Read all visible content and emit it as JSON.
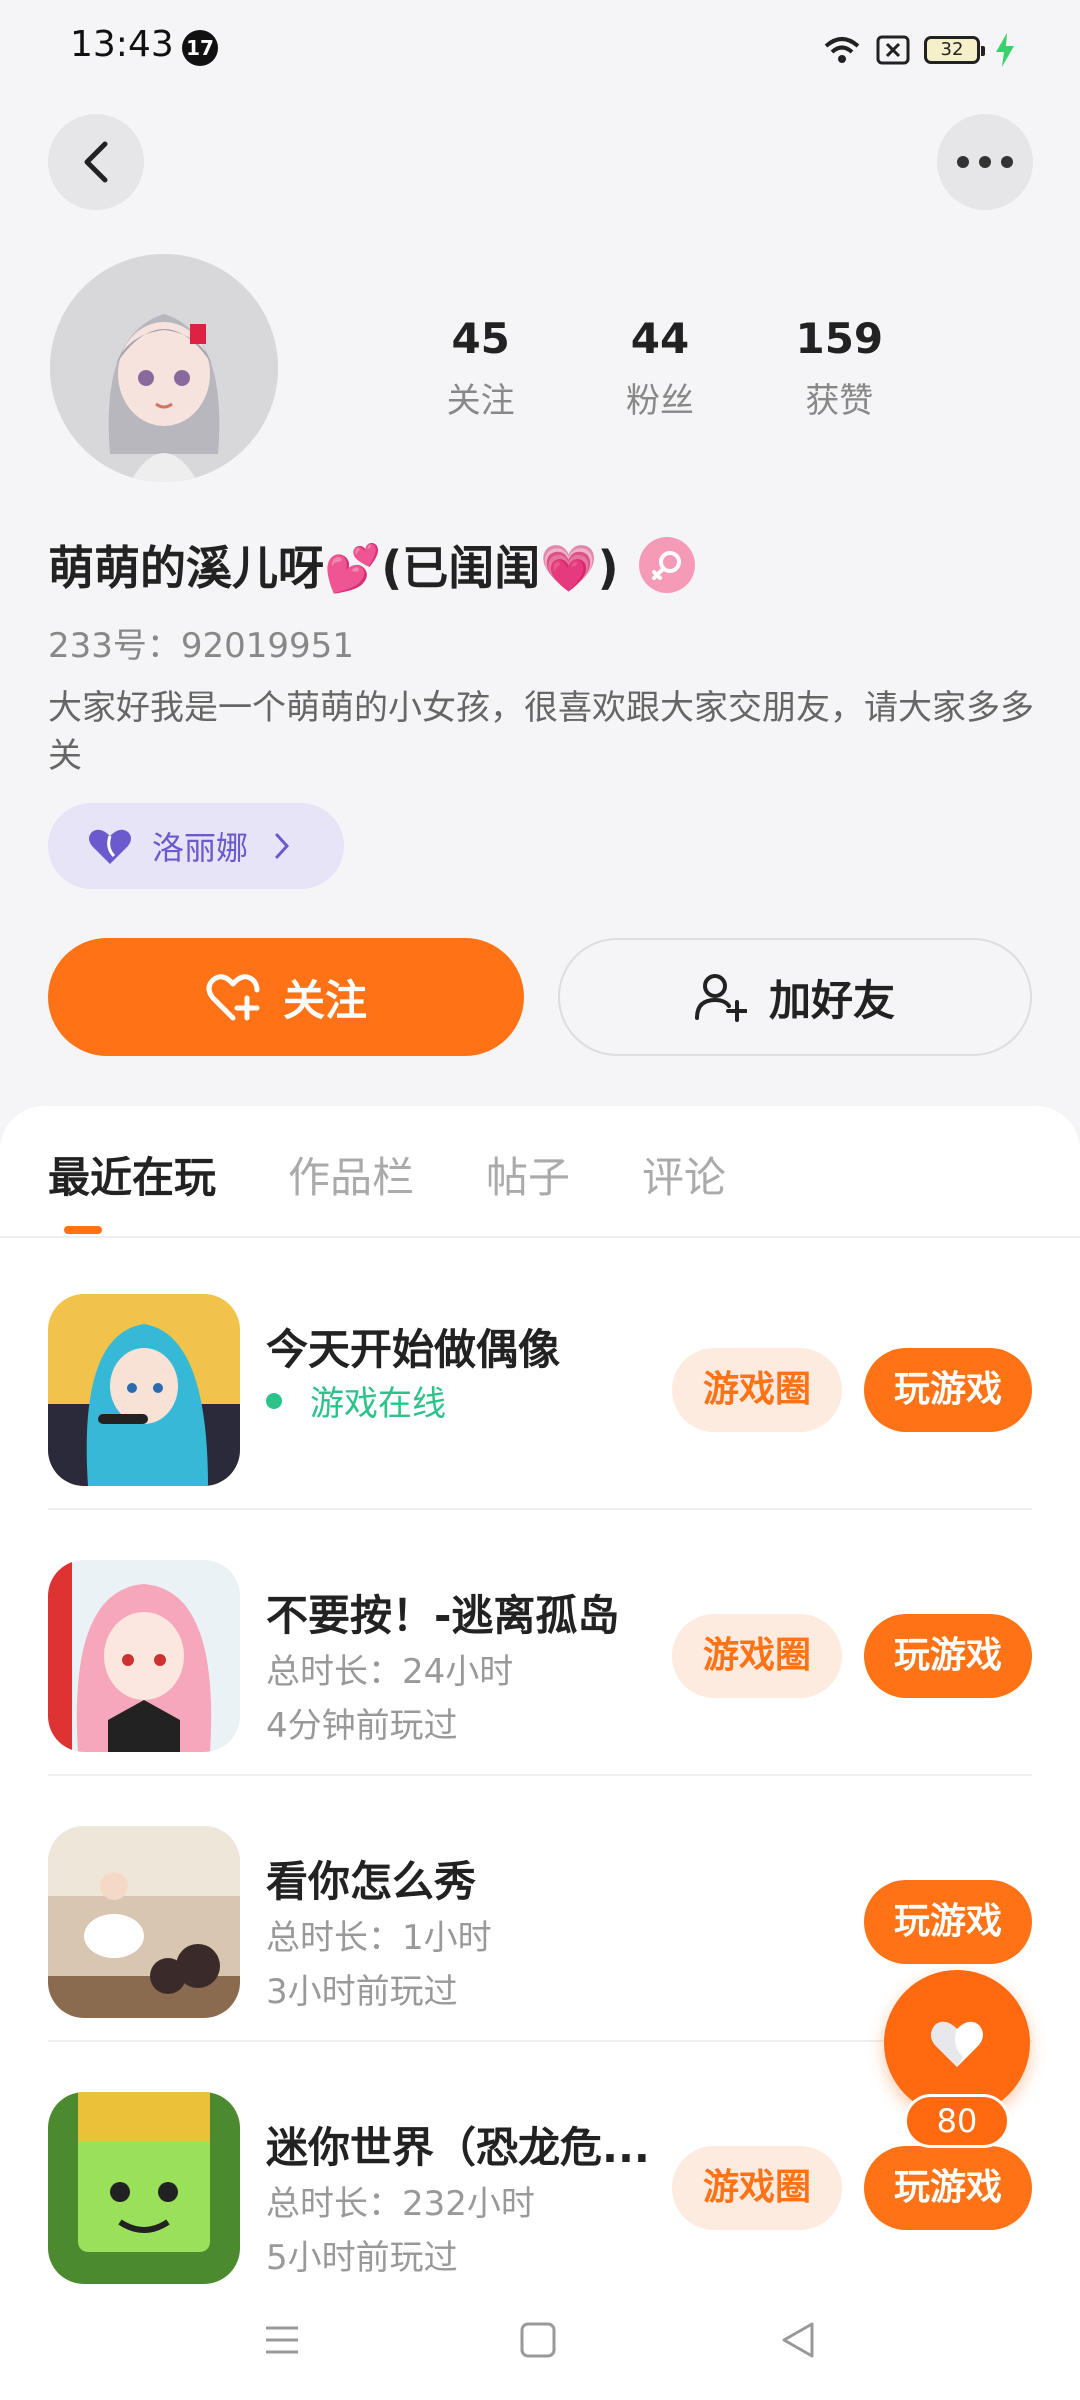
{
  "status_bar": {
    "time": "13:43",
    "badge": "17",
    "battery": "32"
  },
  "profile": {
    "stats": [
      {
        "value": "45",
        "label": "关注"
      },
      {
        "value": "44",
        "label": "粉丝"
      },
      {
        "value": "159",
        "label": "获赞"
      }
    ],
    "name": "萌萌的溪儿呀💕(已闺闺💗)",
    "uid": "233号：92019951",
    "bio": "大家好我是一个萌萌的小女孩，很喜欢跟大家交朋友，请大家多多关",
    "tag": "洛丽娜"
  },
  "actions": {
    "follow": "关注",
    "add_friend": "加好友"
  },
  "tabs": [
    "最近在玩",
    "作品栏",
    "帖子",
    "评论"
  ],
  "games": [
    {
      "title": "今天开始做偶像",
      "online": "游戏在线",
      "circle": "游戏圈",
      "play": "玩游戏"
    },
    {
      "title": "不要按！-逃离孤岛",
      "duration": "总时长：24小时",
      "last": "4分钟前玩过",
      "circle": "游戏圈",
      "play": "玩游戏"
    },
    {
      "title": "看你怎么秀",
      "duration": "总时长：1小时",
      "last": "3小时前玩过",
      "play": "玩游戏"
    },
    {
      "title": "迷你世界（恐龙危...",
      "duration": "总时长：232小时",
      "last": "5小时前玩过",
      "circle": "游戏圈",
      "play": "玩游戏"
    }
  ],
  "like_fab": {
    "count": "80"
  },
  "colors": {
    "accent": "#ff7316",
    "online": "#2bc38a",
    "tag": "#6a5acd"
  }
}
